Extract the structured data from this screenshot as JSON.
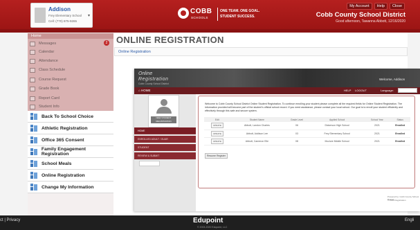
{
  "header": {
    "user": {
      "name": "Addison",
      "school": "Frey Elementary School",
      "phone": "Cell: (770) 875-9265"
    },
    "logo": {
      "brand": "COBB",
      "sub": "SCHOOLS",
      "tagline_1": "ONE TEAM. ONE GOAL.",
      "tagline_2": "STUDENT SUCCESS."
    },
    "links": [
      "My Account",
      "Help",
      "Close"
    ],
    "district": "Cobb County School District",
    "greeting": "Good afternoon, Tawanna Abbott, 12/16/2020"
  },
  "sidebar": {
    "home": "Home",
    "badge": "2",
    "faded_items": [
      "Messages",
      "Calendar",
      "Attendance",
      "Class Schedule",
      "Course Request",
      "Grade Book",
      "Report Card",
      "Student Info"
    ],
    "main_items": [
      "Back To School Choice",
      "Athletic Registration",
      "Office 365 Consent",
      "Family Engagement Registration",
      "School Meals",
      "Online Registration",
      "Change My Information"
    ]
  },
  "main": {
    "title": "ONLINE REGISTRATION",
    "breadcrumb": "Online Registration"
  },
  "frame": {
    "logo_1": "Online",
    "logo_2": "Registration",
    "logo_3": "Cobb County School District",
    "welcome": "Welcome, Addison",
    "nav": {
      "home": "HOME",
      "help": "HELP",
      "logout": "LOGOUT",
      "language": "Language:"
    },
    "photo_label": "NEW STUDENT REGISTRATION",
    "menu": [
      "HOME",
      "ENROLLED ADULT / GUAR",
      "STUDENT",
      "REVIEW & SUBMIT"
    ],
    "intro": "Welcome to Cobb County School District Online Student Registration. To continue enrolling your student please complete all the required fields for Online Student Registration. The information provided will become part of the student's official school record. If you need assistance, please contact your local school. Our goal is to enroll your student efficiently and effectively through this safe and secure system.",
    "table": {
      "headers": [
        "Edit",
        "Student Name",
        "Grade Level",
        "Applied School",
        "School Year",
        "Status"
      ],
      "rows": [
        {
          "action": "UPDATE",
          "name": "Abbott, Landon Charles",
          "grade": "06",
          "school": "Dickerson High School",
          "year": "2021",
          "status": "Enrolled"
        },
        {
          "action": "UPDATE",
          "name": "Abbott, Addison Lee",
          "grade": "03",
          "school": "Frey Elementary School",
          "year": "2021",
          "status": "Enrolled"
        },
        {
          "action": "UPDATE",
          "name": "Abbott, Cameron Elle",
          "grade": "08",
          "school": "Mcclure Middle School",
          "year": "2021",
          "status": "Enrolled"
        }
      ]
    },
    "add_button": "Resume Register",
    "footer_1": "Powered by: Cobb County School District",
    "footer_2": "© 2020 Registration"
  },
  "footer": {
    "left": "ct | Privacy",
    "logo": "Edupoint",
    "copyright": "© 2003-2020 Edupoint, LLC",
    "right": "Engli"
  }
}
